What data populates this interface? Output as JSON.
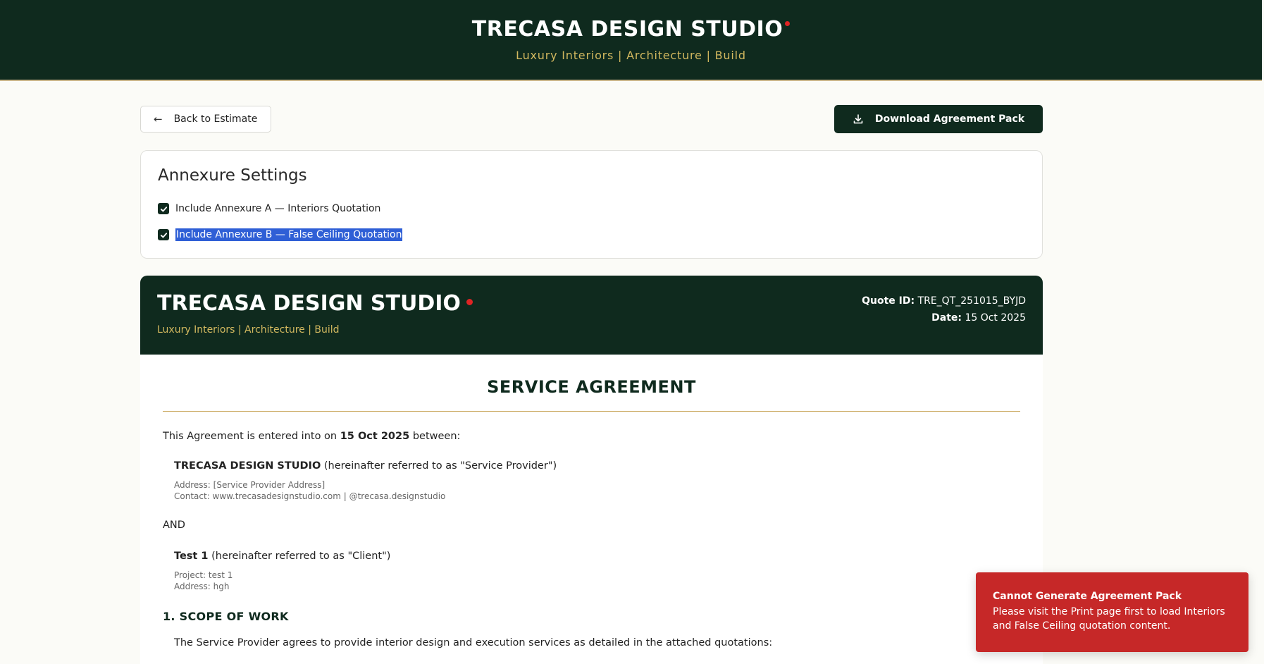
{
  "header": {
    "title": "TRECASA DESIGN STUDIO",
    "tagline": "Luxury Interiors | Architecture | Build"
  },
  "actions": {
    "back_label": "Back to Estimate",
    "download_label": "Download Agreement Pack"
  },
  "annexure_settings": {
    "title": "Annexure Settings",
    "options": [
      {
        "label": "Include Annexure A — Interiors Quotation",
        "checked": true
      },
      {
        "label": "Include Annexure B — False Ceiling Quotation",
        "checked": true
      }
    ]
  },
  "document": {
    "brand": "TRECASA DESIGN STUDIO",
    "tagline": "Luxury Interiors | Architecture | Build",
    "quote_id_label": "Quote ID:",
    "quote_id": "TRE_QT_251015_BYJD",
    "date_label": "Date:",
    "date": "15 Oct 2025",
    "agreement_title": "SERVICE AGREEMENT",
    "intro_prefix": "This Agreement is entered into on",
    "intro_date": "15 Oct 2025",
    "intro_suffix": "between:",
    "provider": {
      "name": "TRECASA DESIGN STUDIO",
      "role": "(hereinafter referred to as \"Service Provider\")",
      "address": "Address: [Service Provider Address]",
      "contact": "Contact: www.trecasadesignstudio.com | @trecasa.designstudio"
    },
    "and_text": "AND",
    "client": {
      "name": "Test 1",
      "role": "(hereinafter referred to as \"Client\")",
      "project": "Project: test 1",
      "address": "Address: hgh"
    },
    "section_1_heading": "1. SCOPE OF WORK",
    "section_1_text": "The Service Provider agrees to provide interior design and execution services as detailed in the attached quotations:"
  },
  "toast": {
    "title": "Cannot Generate Agreement Pack",
    "message": "Please visit the Print page first to load Interiors and False Ceiling quotation content."
  },
  "colors": {
    "brand_green": "#0f2a1e",
    "gold": "#d2b85f",
    "error_red": "#c62828",
    "dot_red": "#e02424",
    "selection_blue": "#2f5fd6"
  }
}
